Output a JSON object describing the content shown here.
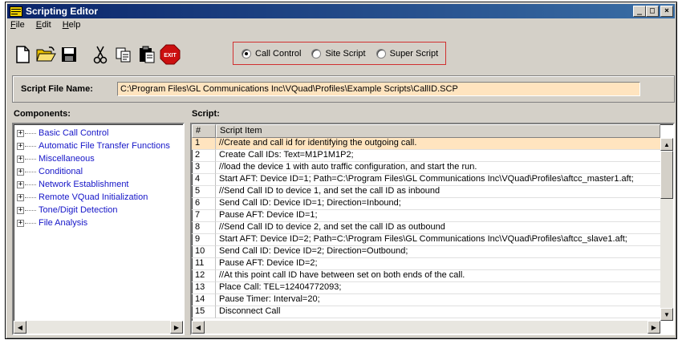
{
  "window": {
    "title": "Scripting Editor"
  },
  "menu": [
    "File",
    "Edit",
    "Help"
  ],
  "toolbar": {
    "buttons": [
      "new-icon",
      "open-icon",
      "save-icon",
      "cut-icon",
      "copy-icon",
      "paste-icon",
      "exit-icon"
    ],
    "exit_label": "EXIT",
    "radios": [
      {
        "label": "Call Control",
        "checked": true
      },
      {
        "label": "Site Script",
        "checked": false
      },
      {
        "label": "Super Script",
        "checked": false
      }
    ]
  },
  "script_file": {
    "label": "Script File Name:",
    "value": "C:\\Program Files\\GL Communications Inc\\VQuad\\Profiles\\Example Scripts\\CallID.SCP"
  },
  "components": {
    "label": "Components:",
    "items": [
      "Basic Call Control",
      "Automatic File Transfer Functions",
      "Miscellaneous",
      "Conditional",
      "Network Establishment",
      "Remote VQuad Initialization",
      "Tone/Digit Detection",
      "File Analysis"
    ]
  },
  "script": {
    "label": "Script:",
    "columns": [
      "#",
      "Script Item"
    ],
    "rows": [
      {
        "n": "1",
        "text": "//Create and call id for identifying the outgoing call."
      },
      {
        "n": "2",
        "text": "Create Call IDs: Text=M1P1M1P2;"
      },
      {
        "n": "3",
        "text": "//load the device 1 with auto traffic configuration, and start the run."
      },
      {
        "n": "4",
        "text": "Start AFT: Device ID=1; Path=C:\\Program Files\\GL Communications Inc\\VQuad\\Profiles\\aftcc_master1.aft;"
      },
      {
        "n": "5",
        "text": "//Send Call ID to device 1, and set the call ID as inbound"
      },
      {
        "n": "6",
        "text": "Send Call ID: Device ID=1; Direction=Inbound;"
      },
      {
        "n": "7",
        "text": "Pause AFT: Device ID=1;"
      },
      {
        "n": "8",
        "text": "//Send Call ID to device 2, and set the call ID as outbound"
      },
      {
        "n": "9",
        "text": "Start AFT: Device ID=2; Path=C:\\Program Files\\GL Communications Inc\\VQuad\\Profiles\\aftcc_slave1.aft;"
      },
      {
        "n": "10",
        "text": "Send Call ID: Device ID=2; Direction=Outbound;"
      },
      {
        "n": "11",
        "text": "Pause AFT: Device ID=2;"
      },
      {
        "n": "12",
        "text": "//At this point call ID have between set on both ends of the call."
      },
      {
        "n": "13",
        "text": "Place Call: TEL=12404772093;"
      },
      {
        "n": "14",
        "text": "Pause Timer: Interval=20;"
      },
      {
        "n": "15",
        "text": "Disconnect Call"
      }
    ],
    "selected_row": 1
  },
  "colors": {
    "highlight": "#ffe4bf",
    "link": "#1515c8",
    "titlebar": "#0a246a",
    "radio_border": "#d03030"
  }
}
